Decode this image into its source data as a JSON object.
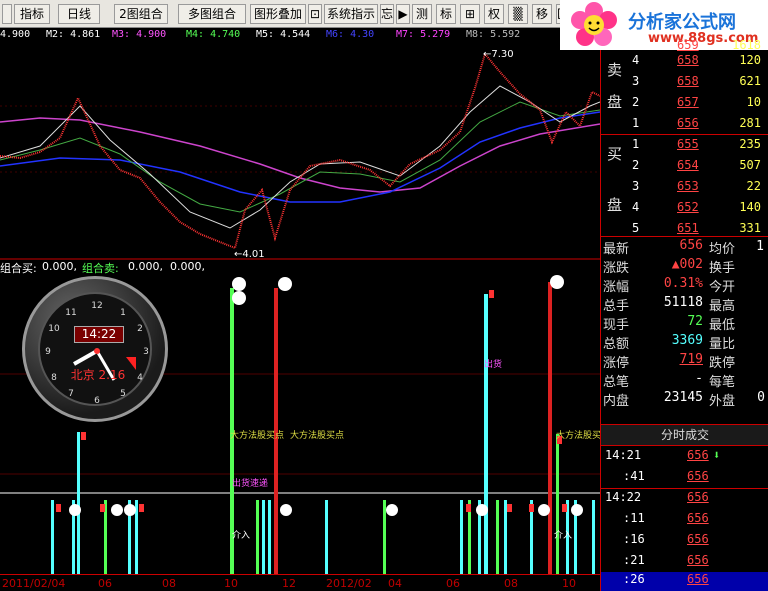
{
  "toolbar": {
    "buttons": [
      "指标",
      "日线",
      "2图组合",
      "多图组合",
      "图形叠加",
      "系统指示",
      "忘",
      "▶",
      "测",
      "标",
      "⊞",
      "权",
      "▒",
      "移",
      "匠"
    ]
  },
  "ma": [
    {
      "text": "4.900",
      "color": "#ffffff"
    },
    {
      "text": "M2: 4.861",
      "color": "#ffffff"
    },
    {
      "text": "M3: 4.900",
      "color": "#ff55ff"
    },
    {
      "text": "M4: 4.740",
      "color": "#55ff55"
    },
    {
      "text": "M5: 4.544",
      "color": "#ffffff"
    },
    {
      "text": "M6: 4.30",
      "color": "#4444ff"
    },
    {
      "text": "M7: 5.279",
      "color": "#ff44ff"
    },
    {
      "text": "M8: 5.592",
      "color": "#bbbbbb"
    }
  ],
  "main_chart": {
    "high_label": "7.30",
    "low_label": "4.01"
  },
  "indicator_header": {
    "label1": "组合买:",
    "value1": "0.000,",
    "label2": "组合卖:",
    "value2": "0.000,",
    "value3": "0.000,"
  },
  "clock": {
    "time": "14:22",
    "caption": "北京 2.16"
  },
  "chart_labels": {
    "a1": "大方法股买点",
    "a2": "大方法股买点",
    "a3": "出货",
    "a4": "大方法股买点",
    "a5": "出货速递",
    "a6": "介入",
    "a7": "介入"
  },
  "date_axis": [
    "2011/02/04",
    "06",
    "08",
    "10",
    "12",
    "2012/02",
    "04",
    "06",
    "08",
    "10"
  ],
  "logo": {
    "title": "分析家公式网",
    "url": "www.88gs.com"
  },
  "order_book": {
    "sell": [
      {
        "side": "",
        "level": "5",
        "price": "659",
        "vol": "1618"
      },
      {
        "side": "卖",
        "level": "4",
        "price": "658",
        "vol": "120"
      },
      {
        "side": "",
        "level": "3",
        "price": "658",
        "vol": "621"
      },
      {
        "side": "盘",
        "level": "2",
        "price": "657",
        "vol": "10"
      },
      {
        "side": "",
        "level": "1",
        "price": "656",
        "vol": "281"
      }
    ],
    "buy": [
      {
        "side": "买",
        "level": "1",
        "price": "655",
        "vol": "235"
      },
      {
        "side": "",
        "level": "2",
        "price": "654",
        "vol": "507"
      },
      {
        "side": "",
        "level": "3",
        "price": "653",
        "vol": "22"
      },
      {
        "side": "盘",
        "level": "4",
        "price": "652",
        "vol": "140"
      },
      {
        "side": "",
        "level": "5",
        "price": "651",
        "vol": "331"
      }
    ]
  },
  "quote": {
    "rows": [
      {
        "l1": "最新",
        "v1": "656",
        "c1": "#ff4444",
        "l2": "均价"
      },
      {
        "l1": "涨跌",
        "v1": "▲002",
        "c1": "#ff4444",
        "l2": "换手"
      },
      {
        "l1": "涨幅",
        "v1": "0.31%",
        "c1": "#ff4444",
        "l2": "今开"
      },
      {
        "l1": "总手",
        "v1": "51118",
        "c1": "#ffffff",
        "l2": "最高"
      },
      {
        "l1": "现手",
        "v1": "72",
        "c1": "#55ff55",
        "l2": "最低"
      },
      {
        "l1": "总额",
        "v1": "3369",
        "c1": "#55ffff",
        "l2": "量比"
      },
      {
        "l1": "涨停",
        "v1": "719",
        "c1": "#ff4444",
        "l2": "跌停"
      },
      {
        "l1": "总笔",
        "v1": "-",
        "c1": "#ffffff",
        "l2": "每笔"
      },
      {
        "l1": "内盘",
        "v1": "23145",
        "c1": "#ffffff",
        "l2": "外盘"
      }
    ],
    "extra": [
      "0",
      "1"
    ]
  },
  "ticks": {
    "header": "分时成交",
    "rows": [
      {
        "time": "14:21",
        "price": "656",
        "vol": "",
        "arrow": "⬇"
      },
      {
        "time": ":41",
        "price": "656",
        "vol": ""
      },
      {
        "time": "14:22",
        "price": "656",
        "vol": ""
      },
      {
        "time": ":11",
        "price": "656",
        "vol": ""
      },
      {
        "time": ":16",
        "price": "656",
        "vol": ""
      },
      {
        "time": ":21",
        "price": "656",
        "vol": ""
      },
      {
        "time": ":26",
        "price": "656",
        "vol": ""
      }
    ]
  },
  "colors": {
    "up": "#ff4444",
    "down": "#55ffff",
    "accent": "#c00000"
  }
}
